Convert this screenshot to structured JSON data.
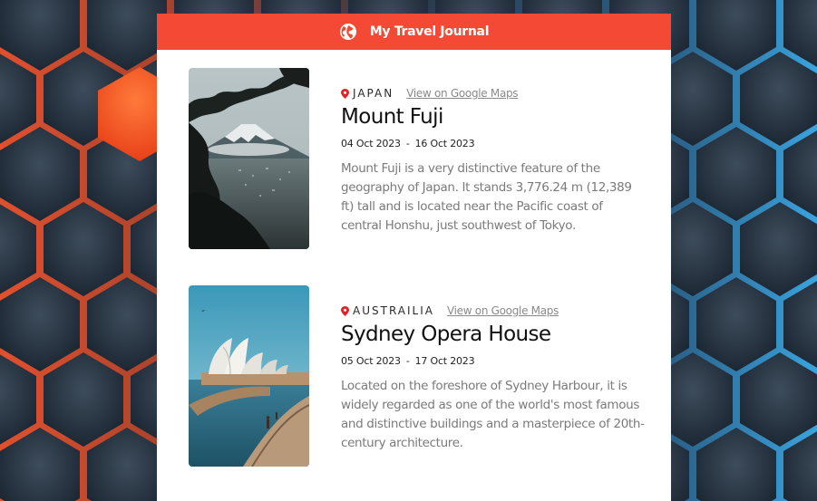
{
  "header": {
    "title": "My Travel Journal",
    "icon": "globe-icon",
    "color": "#f44a35"
  },
  "entries": [
    {
      "country": "JAPAN",
      "map_link": "View on Google Maps",
      "title": "Mount Fuji",
      "start_date": "04 Oct 2023",
      "date_separator": "-",
      "end_date": "16 Oct 2023",
      "description": "Mount Fuji is a very distinctive feature of the geography of Japan. It stands 3,776.24 m (12,389 ft) tall and is located near the Pacific coast of central Honshu, just southwest of Tokyo."
    },
    {
      "country": "AUSTRAILIA",
      "map_link": "View on Google Maps",
      "title": "Sydney Opera House",
      "start_date": "05 Oct 2023",
      "date_separator": "-",
      "end_date": "17 Oct 2023",
      "description": "Located on the foreshore of Sydney Harbour, it is widely regarded as one of the world's most famous and distinctive buildings and a masterpiece of 20th-century architecture."
    }
  ],
  "colors": {
    "pin": "#e02424",
    "background": "#1e2a36",
    "hex_glow_orange": "#ff5a2a",
    "hex_glow_blue": "#3aa8e8"
  }
}
